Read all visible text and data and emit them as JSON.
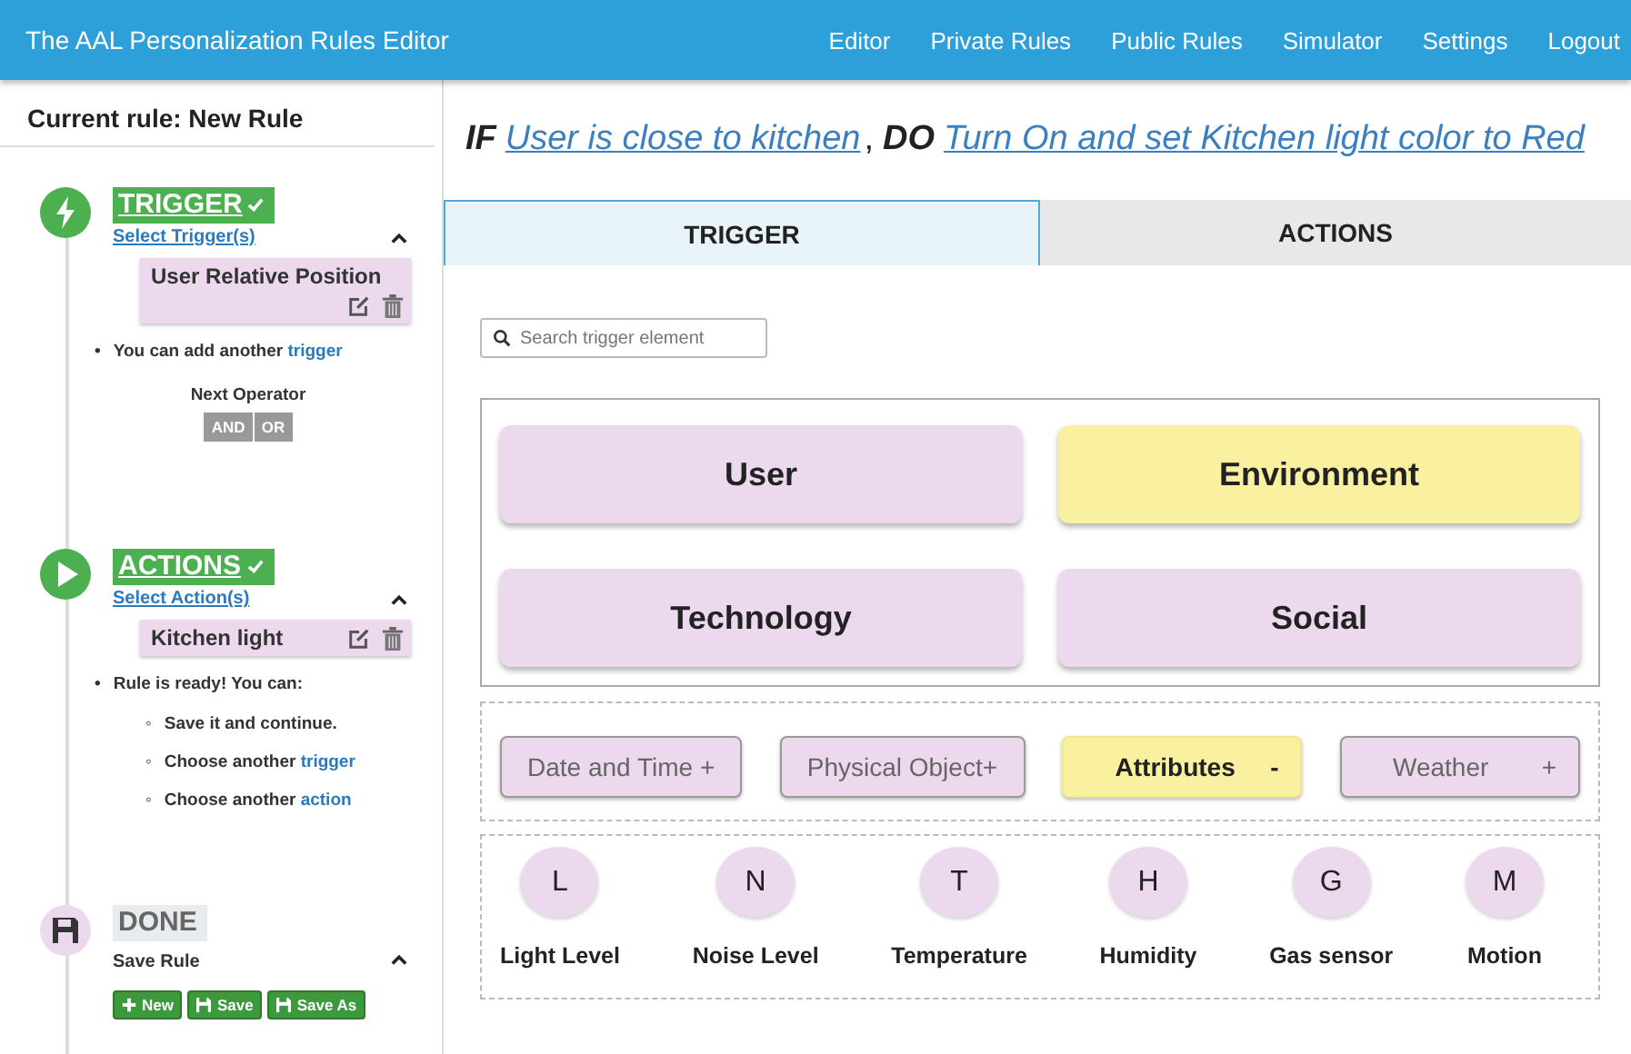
{
  "navbar": {
    "title": "The AAL Personalization Rules Editor",
    "links": [
      "Editor",
      "Private Rules",
      "Public Rules",
      "Simulator",
      "Settings",
      "Logout"
    ]
  },
  "sidebar": {
    "heading": "Current rule: New Rule",
    "steps": [
      {
        "kind": "trigger",
        "title": "TRIGGER",
        "complete": true,
        "link": "Select Trigger(s)",
        "expanded": true,
        "items": [
          "User Relative Position"
        ],
        "notes": [
          {
            "marker": "•",
            "text": "You can add another ",
            "link": "trigger"
          }
        ],
        "operator": {
          "label": "Next Operator",
          "options": [
            {
              "label": "AND",
              "selected": false
            },
            {
              "label": "OR",
              "selected": false
            }
          ]
        }
      },
      {
        "kind": "action",
        "title": "ACTIONS",
        "complete": true,
        "link": "Select Action(s)",
        "expanded": true,
        "items": [
          "Kitchen light"
        ],
        "notes": [
          {
            "marker": "•",
            "text": "Rule is ready! You can:"
          }
        ],
        "options": [
          {
            "marker": "◦",
            "text": "Save it and continue."
          },
          {
            "marker": "◦",
            "text": "Choose another ",
            "link": "trigger"
          },
          {
            "marker": "◦",
            "text": "Choose another ",
            "link": "action"
          }
        ]
      },
      {
        "kind": "save",
        "title": "DONE",
        "complete": false,
        "subtitle": "Save Rule",
        "expanded": true,
        "buttons": [
          {
            "kind": "new",
            "label": "New"
          },
          {
            "kind": "save",
            "label": "Save"
          },
          {
            "kind": "save",
            "label": "Save As"
          }
        ]
      }
    ]
  },
  "summary": {
    "if": "IF",
    "condition": "User is close to kitchen ",
    "separator": ",",
    "do": "DO",
    "action": "Turn On and set Kitchen light color to Red"
  },
  "tabs": [
    {
      "label": "TRIGGER",
      "selected": true
    },
    {
      "label": "ACTIONS",
      "selected": false
    }
  ],
  "search": {
    "placeholder": "Search trigger element"
  },
  "categories": [
    {
      "label": "User",
      "selected": false
    },
    {
      "label": "Environment",
      "selected": true
    },
    {
      "label": "Technology",
      "selected": false
    },
    {
      "label": "Social",
      "selected": false
    }
  ],
  "subcategories": [
    {
      "label": "Date and Time +",
      "selected": false
    },
    {
      "label": "Physical Object+",
      "selected": false
    },
    {
      "label": "Attributes",
      "sign": "-",
      "selected": true
    },
    {
      "label": "Weather",
      "sign": "+",
      "selected": false
    }
  ],
  "elements": [
    {
      "letter": "L",
      "label": "Light Level"
    },
    {
      "letter": "N",
      "label": "Noise Level"
    },
    {
      "letter": "T",
      "label": "Temperature"
    },
    {
      "letter": "H",
      "label": "Humidity"
    },
    {
      "letter": "G",
      "label": "Gas sensor"
    },
    {
      "letter": "M",
      "label": "Motion"
    }
  ]
}
